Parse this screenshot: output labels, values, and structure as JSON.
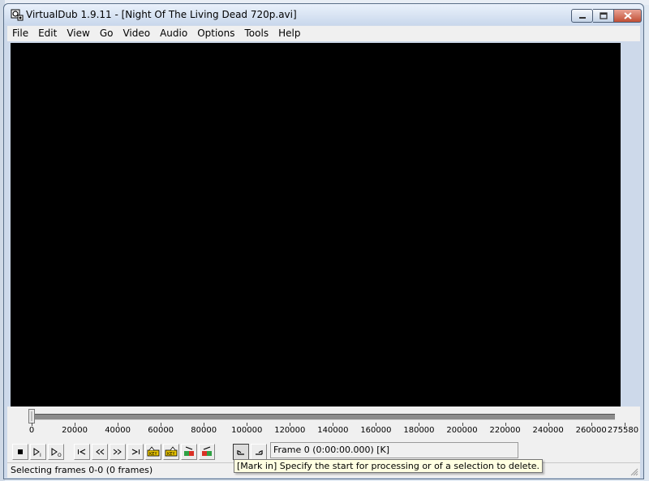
{
  "window": {
    "title": "VirtualDub 1.9.11 - [Night Of The Living Dead 720p.avi]"
  },
  "menu": [
    "File",
    "Edit",
    "View",
    "Go",
    "Video",
    "Audio",
    "Options",
    "Tools",
    "Help"
  ],
  "timeline": {
    "position_frame": 0,
    "max_frame": 275580,
    "tick_labels": [
      "0",
      "20000",
      "40000",
      "60000",
      "80000",
      "100000",
      "120000",
      "140000",
      "160000",
      "180000",
      "200000",
      "220000",
      "240000",
      "260000",
      "275580"
    ]
  },
  "toolbar": {
    "buttons": [
      {
        "name": "stop-icon"
      },
      {
        "name": "play-input-icon"
      },
      {
        "name": "play-output-icon"
      },
      {
        "name": "go-to-start-icon"
      },
      {
        "name": "step-backward-icon"
      },
      {
        "name": "step-forward-icon"
      },
      {
        "name": "go-to-end-icon"
      },
      {
        "name": "prev-keyframe-icon"
      },
      {
        "name": "next-keyframe-icon"
      },
      {
        "name": "scene-back-icon"
      },
      {
        "name": "scene-forward-icon"
      },
      {
        "name": "mark-in-icon"
      },
      {
        "name": "mark-out-icon"
      }
    ],
    "frame_info": "Frame 0 (0:00:00.000) [K]"
  },
  "status": {
    "text": "Selecting frames 0-0 (0 frames)"
  },
  "tooltip": {
    "text": "[Mark in] Specify the start for processing or of a selection to delete."
  },
  "colors": {
    "video_bg": "#000000",
    "tooltip_bg": "#ffffe1",
    "close_button": "#c14f35"
  }
}
